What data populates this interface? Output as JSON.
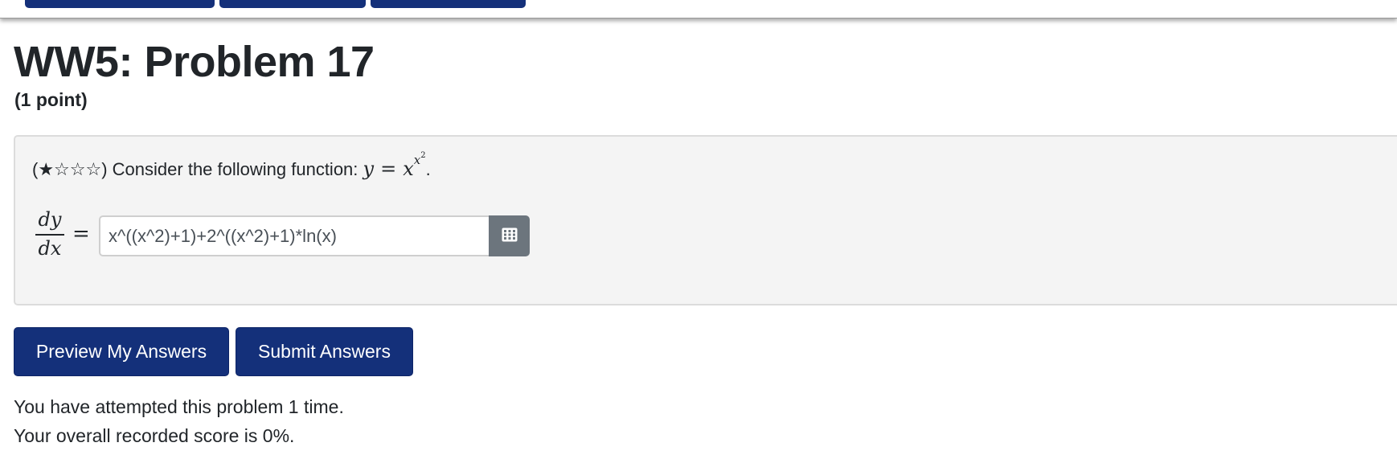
{
  "header": {
    "title": "WW5: Problem 17",
    "points": "(1 point)"
  },
  "problem": {
    "difficulty": "(★☆☆☆)",
    "statement_text": "Consider the following function:",
    "math": {
      "lhs": "y",
      "eq": "=",
      "base": "x",
      "exponent_base": "x",
      "exponent_power": "2",
      "end": "."
    },
    "derivative_label": {
      "numerator": "dy",
      "denominator": "dx",
      "eq": "="
    },
    "answer": {
      "value": "x^((x^2)+1)+2^((x^2)+1)*ln(x)"
    },
    "calculator_icon": "grid-calculator-icon"
  },
  "buttons": {
    "preview_label": "Preview My Answers",
    "submit_label": "Submit Answers"
  },
  "status": {
    "attempts_text": "You have attempted this problem 1 time.",
    "score_text": "Your overall recorded score is 0%."
  },
  "colors": {
    "primary": "#14307a",
    "calc_button": "#6c757d",
    "panel_bg": "#f4f4f4"
  }
}
